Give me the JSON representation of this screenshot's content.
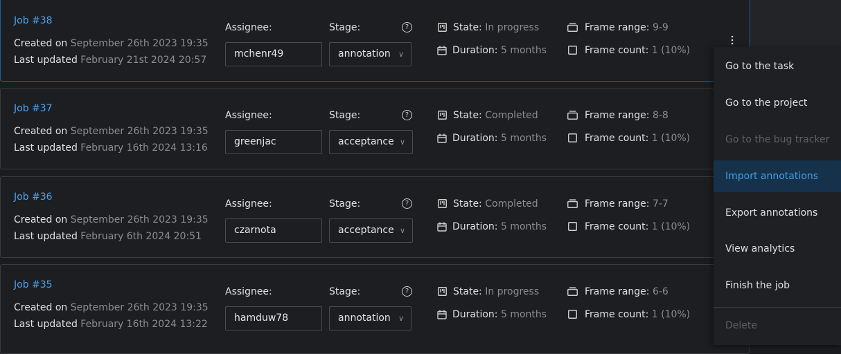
{
  "jobs": [
    {
      "id": "Job #38",
      "created_prefix": "Created on",
      "created": "September 26th 2023 19:35",
      "updated_prefix": "Last updated",
      "updated": "February 21st 2024 20:57",
      "assignee_label": "Assignee:",
      "assignee": "mchenr49",
      "stage_label": "Stage:",
      "stage": "annotation",
      "state_label": "State:",
      "state": "In progress",
      "duration_label": "Duration:",
      "duration": "5 months",
      "frame_range_label": "Frame range:",
      "frame_range": "9-9",
      "frame_count_label": "Frame count:",
      "frame_count": "1 (10%)"
    },
    {
      "id": "Job #37",
      "created_prefix": "Created on",
      "created": "September 26th 2023 19:35",
      "updated_prefix": "Last updated",
      "updated": "February 16th 2024 13:16",
      "assignee_label": "Assignee:",
      "assignee": "greenjac",
      "stage_label": "Stage:",
      "stage": "acceptance",
      "state_label": "State:",
      "state": "Completed",
      "duration_label": "Duration:",
      "duration": "5 months",
      "frame_range_label": "Frame range:",
      "frame_range": "8-8",
      "frame_count_label": "Frame count:",
      "frame_count": "1 (10%)"
    },
    {
      "id": "Job #36",
      "created_prefix": "Created on",
      "created": "September 26th 2023 19:35",
      "updated_prefix": "Last updated",
      "updated": "February 6th 2024 20:51",
      "assignee_label": "Assignee:",
      "assignee": "czarnota",
      "stage_label": "Stage:",
      "stage": "acceptance",
      "state_label": "State:",
      "state": "Completed",
      "duration_label": "Duration:",
      "duration": "5 months",
      "frame_range_label": "Frame range:",
      "frame_range": "7-7",
      "frame_count_label": "Frame count:",
      "frame_count": "1 (10%)"
    },
    {
      "id": "Job #35",
      "created_prefix": "Created on",
      "created": "September 26th 2023 19:35",
      "updated_prefix": "Last updated",
      "updated": "February 16th 2024 13:22",
      "assignee_label": "Assignee:",
      "assignee": "hamduw78",
      "stage_label": "Stage:",
      "stage": "annotation",
      "state_label": "State:",
      "state": "In progress",
      "duration_label": "Duration:",
      "duration": "5 months",
      "frame_range_label": "Frame range:",
      "frame_range": "6-6",
      "frame_count_label": "Frame count:",
      "frame_count": "1 (10%)"
    }
  ],
  "context_menu": {
    "items": [
      {
        "label": "Go to the task",
        "state": "normal"
      },
      {
        "label": "Go to the project",
        "state": "normal"
      },
      {
        "label": "Go to the bug tracker",
        "state": "disabled"
      },
      {
        "label": "Import annotations",
        "state": "active"
      },
      {
        "label": "Export annotations",
        "state": "normal"
      },
      {
        "label": "View analytics",
        "state": "normal"
      },
      {
        "label": "Finish the job",
        "state": "normal"
      },
      {
        "label": "Delete",
        "state": "disabled"
      }
    ]
  },
  "icons": {
    "help": "question-circle-icon",
    "state": "board-icon",
    "duration": "calendar-icon",
    "frame_range": "frames-icon",
    "frame_count": "square-icon",
    "stage_chevron": "chevron-down-icon",
    "more": "vertical-ellipsis-icon"
  },
  "colors": {
    "link": "#4aa3f0",
    "selected_border": "#1f5f9b",
    "menu_active_bg": "#16324a",
    "muted": "#8c8d91"
  }
}
